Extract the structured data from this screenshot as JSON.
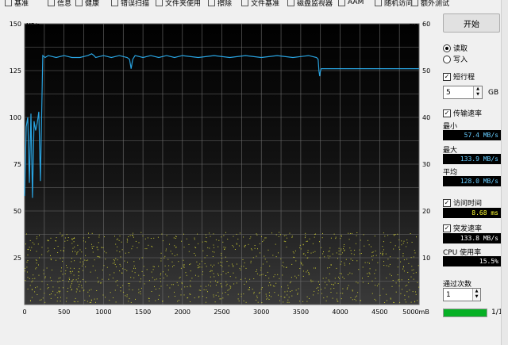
{
  "tabs": [
    {
      "label": "基准",
      "icon": "benchmark-icon"
    },
    {
      "label": "信息",
      "icon": "info-icon"
    },
    {
      "label": "健康",
      "icon": "health-icon"
    },
    {
      "label": "错误扫描",
      "icon": "error-scan-icon"
    },
    {
      "label": "文件夹使用",
      "icon": "folder-icon"
    },
    {
      "label": "擦除",
      "icon": "erase-icon"
    },
    {
      "label": "文件基准",
      "icon": "file-benchmark-icon"
    },
    {
      "label": "磁盘监视器",
      "icon": "disk-monitor-icon"
    },
    {
      "label": "AAM",
      "icon": "aam-icon"
    },
    {
      "label": "随机访问",
      "icon": "random-access-icon"
    },
    {
      "label": "额外测试",
      "icon": "extra-tests-icon"
    }
  ],
  "chart_data": {
    "type": "line",
    "xlabel": "",
    "x_ticks": [
      "0",
      "500",
      "1000",
      "1500",
      "2000",
      "2500",
      "3000",
      "3500",
      "4000",
      "4500",
      "5000mB"
    ],
    "xlim": [
      0,
      5000
    ],
    "y_left_unit": "MB/s",
    "y_left_ticks": [
      "150",
      "125",
      "100",
      "75",
      "50",
      "25"
    ],
    "ylim_left": [
      0,
      150
    ],
    "y_right_unit": "ms",
    "y_right_ticks": [
      "60",
      "50",
      "40",
      "30",
      "20",
      "10"
    ],
    "ylim_right": [
      0,
      60
    ],
    "grid": true,
    "colors": {
      "transfer": "#29a3e0",
      "access": "#c8c832",
      "background": "#000000",
      "grid": "#6e6e6e"
    },
    "series": [
      {
        "role": "transfer-rate",
        "x": [
          0,
          20,
          40,
          60,
          80,
          100,
          120,
          140,
          160,
          180,
          200,
          230,
          260,
          300,
          400,
          500,
          600,
          700,
          800,
          850,
          880,
          900,
          1000,
          1100,
          1200,
          1300,
          1330,
          1350,
          1370,
          1400,
          1500,
          1600,
          1700,
          1800,
          1900,
          2000,
          2200,
          2400,
          2600,
          2800,
          3000,
          3200,
          3400,
          3600,
          3700,
          3720,
          3730,
          3740,
          3750,
          3760,
          3800,
          4000,
          4200,
          4400,
          4600,
          4800,
          5000
        ],
        "y": [
          58,
          95,
          100,
          65,
          102,
          57,
          98,
          93,
          97,
          103,
          66,
          133,
          132,
          133,
          132,
          133,
          132,
          132,
          133,
          134,
          133,
          132,
          133,
          132,
          133,
          132,
          131,
          126,
          131,
          133,
          132,
          133,
          132,
          133,
          132,
          133,
          132,
          133,
          132,
          133,
          132,
          133,
          132,
          133,
          132,
          131,
          125,
          122,
          125,
          126,
          126,
          126,
          126,
          126,
          126,
          126,
          126
        ]
      },
      {
        "role": "access-time-ms",
        "x_range": [
          0,
          5000
        ],
        "y_range_ms": [
          0.5,
          15.5
        ],
        "count": 1100,
        "seed": 7
      }
    ]
  },
  "panel": {
    "start_label": "开始",
    "read_label": "读取",
    "write_label": "写入",
    "mode": "read",
    "short_stroke_label": "短行程",
    "short_stroke_checked": true,
    "short_stroke_value": "5",
    "short_stroke_unit": "GB",
    "transfer_rate_label": "传输速率",
    "transfer_rate_checked": true,
    "min_label": "最小",
    "min_value": "57.4 MB/s",
    "max_label": "最大",
    "max_value": "133.9 MB/s",
    "avg_label": "平均",
    "avg_value": "128.0 MB/s",
    "access_time_label": "访问时间",
    "access_time_checked": true,
    "access_time_value": "8.68 ms",
    "burst_rate_label": "突发速率",
    "burst_rate_checked": true,
    "burst_rate_value": "133.8 MB/s",
    "cpu_label": "CPU 使用率",
    "cpu_value": "15.5%",
    "passes_label": "通过次数",
    "passes_value": "1",
    "progress_fraction": 1.0,
    "progress_text": "1/1"
  }
}
